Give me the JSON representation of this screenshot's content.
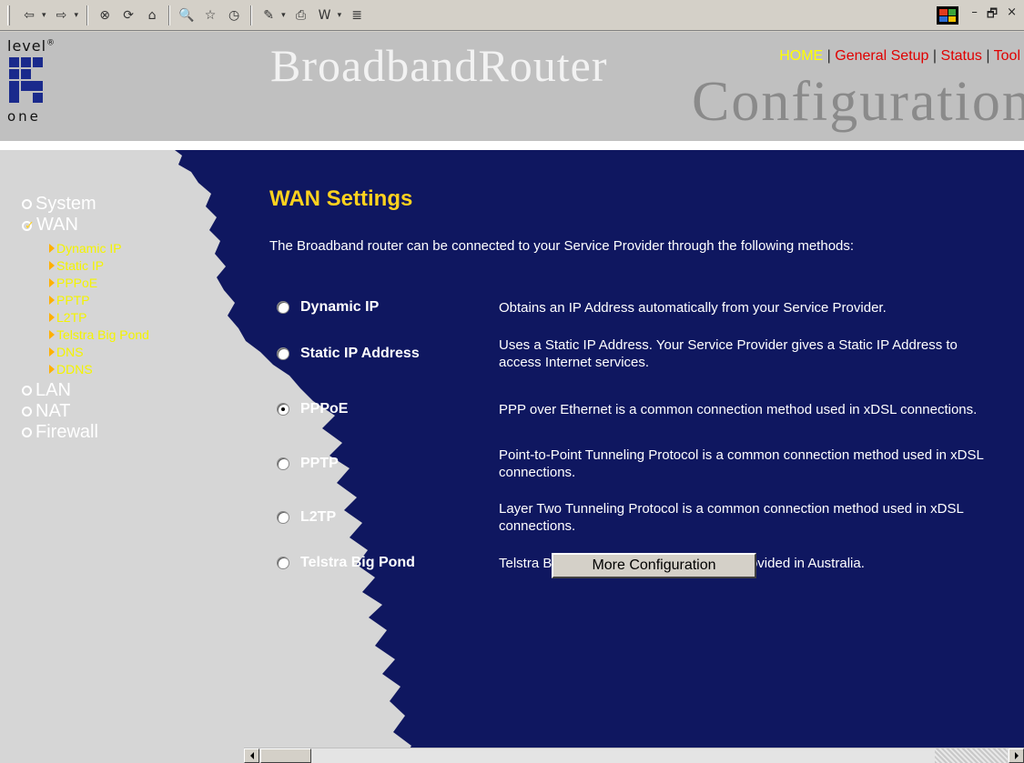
{
  "browser_toolbar": {
    "buttons": [
      {
        "name": "back-button",
        "glyph": "⇦",
        "has_dropdown": true
      },
      {
        "name": "forward-button",
        "glyph": "⇨",
        "has_dropdown": true
      },
      {
        "name": "stop-button",
        "glyph": "⊗"
      },
      {
        "name": "refresh-button",
        "glyph": "⟳"
      },
      {
        "name": "home-button",
        "glyph": "⌂"
      },
      {
        "name": "search-button",
        "glyph": "🔍"
      },
      {
        "name": "favorites-button",
        "glyph": "☆"
      },
      {
        "name": "history-button",
        "glyph": "◷"
      },
      {
        "name": "edit-button",
        "glyph": "✎",
        "has_dropdown": true
      },
      {
        "name": "print-button",
        "glyph": "⎙"
      },
      {
        "name": "word-button",
        "glyph": "W",
        "has_dropdown": true
      },
      {
        "name": "discuss-button",
        "glyph": "≣"
      }
    ],
    "window_controls": {
      "minimize": "–",
      "restore": "🗗",
      "close": "×"
    }
  },
  "header": {
    "logo": {
      "top": "level",
      "mark": "®",
      "bottom": "one"
    },
    "title_main": "BroadbandRouter",
    "title_sub": "Configuration",
    "nav": {
      "home": "HOME",
      "separator": "|",
      "general_setup": "General Setup",
      "status": "Status",
      "tools": "Tool"
    }
  },
  "sidebar": {
    "system": "System",
    "wan": "WAN",
    "wan_items": [
      "Dynamic IP",
      "Static IP",
      "PPPoE",
      "PPTP",
      "L2TP",
      "Telstra Big Pond",
      "DNS",
      "DDNS"
    ],
    "lan": "LAN",
    "nat": "NAT",
    "firewall": "Firewall"
  },
  "main": {
    "title": "WAN Settings",
    "intro": "The Broadband router can be connected to your Service Provider through the following methods:",
    "options": [
      {
        "label": "Dynamic IP",
        "description": "Obtains an IP Address automatically from your Service Provider.",
        "selected": false
      },
      {
        "label": "Static IP Address",
        "description": "Uses a Static IP Address. Your Service Provider gives a Static IP Address to access Internet services.",
        "selected": false
      },
      {
        "label": "PPPoE",
        "description": "PPP over Ethernet is a common connection method used in xDSL connections.",
        "selected": true
      },
      {
        "label": "PPTP",
        "description": "Point-to-Point Tunneling Protocol is a common connection method used in xDSL connections.",
        "selected": false
      },
      {
        "label": "L2TP",
        "description": "Layer Two Tunneling Protocol is a common connection method used in xDSL connections.",
        "selected": false
      },
      {
        "label": "Telstra Big Pond",
        "description": "Telstra Big Pond is a Internet service is provided in Australia.",
        "selected": false
      }
    ],
    "more_button": "More Configuration"
  },
  "colors": {
    "panel_blue": "#0f1760",
    "sidebar_grey": "#d6d6d6",
    "header_grey": "#c0c0c0",
    "title_yellow": "#ffd21e",
    "submenu_yellow": "#f4f400",
    "nav_red": "#e00000"
  }
}
